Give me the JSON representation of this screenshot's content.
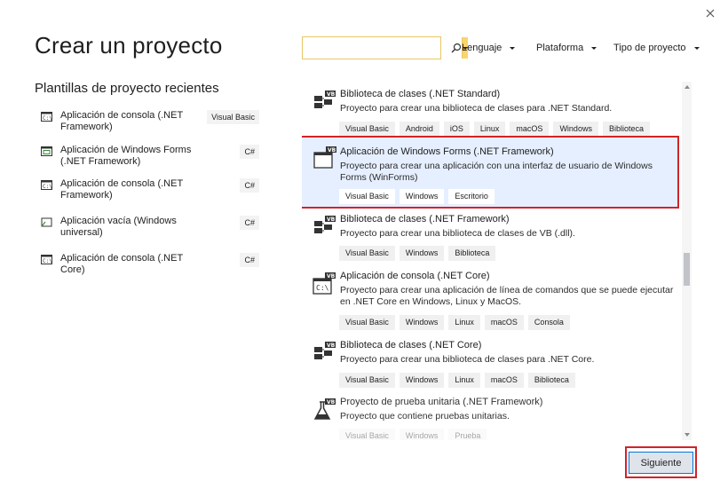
{
  "window": {
    "close_icon": "close-icon"
  },
  "header": {
    "title": "Crear un proyecto",
    "search": {
      "value": "",
      "placeholder": ""
    },
    "filters": {
      "language": "Lenguaje",
      "platform": "Plataforma",
      "project_type": "Tipo de proyecto"
    }
  },
  "recent": {
    "title": "Plantillas de proyecto recientes",
    "items": [
      {
        "label": "Aplicación de consola (.NET Framework)",
        "badge": "Visual Basic",
        "icon": "console-icon"
      },
      {
        "label": "Aplicación de Windows Forms (.NET Framework)",
        "badge": "C#",
        "icon": "windows-forms-icon"
      },
      {
        "label": "Aplicación de consola (.NET Framework)",
        "badge": "C#",
        "icon": "console-icon"
      },
      {
        "label": "Aplicación vacía (Windows universal)",
        "badge": "C#",
        "icon": "uwp-icon"
      },
      {
        "label": "Aplicación de consola (.NET Core)",
        "badge": "C#",
        "icon": "console-icon"
      }
    ]
  },
  "templates": [
    {
      "name": "Biblioteca de clases (.NET Standard)",
      "desc": "Proyecto para crear una biblioteca de clases para .NET Standard.",
      "tags": [
        "Visual Basic",
        "Android",
        "iOS",
        "Linux",
        "macOS",
        "Windows",
        "Biblioteca"
      ],
      "icon": "vb-class-library-icon"
    },
    {
      "name": "Aplicación de Windows Forms (.NET Framework)",
      "desc": "Proyecto para crear una aplicación con una interfaz de usuario de Windows Forms (WinForms)",
      "tags": [
        "Visual Basic",
        "Windows",
        "Escritorio"
      ],
      "icon": "vb-windows-forms-icon"
    },
    {
      "name": "Biblioteca de clases (.NET Framework)",
      "desc": "Proyecto para crear una biblioteca de clases de VB (.dll).",
      "tags": [
        "Visual Basic",
        "Windows",
        "Biblioteca"
      ],
      "icon": "vb-class-library-icon"
    },
    {
      "name": "Aplicación de consola (.NET Core)",
      "desc": "Proyecto para crear una aplicación de línea de comandos que se puede ejecutar en .NET Core en Windows, Linux y MacOS.",
      "tags": [
        "Visual Basic",
        "Windows",
        "Linux",
        "macOS",
        "Consola"
      ],
      "icon": "vb-console-icon"
    },
    {
      "name": "Biblioteca de clases (.NET Core)",
      "desc": "Proyecto para crear una biblioteca de clases para .NET Core.",
      "tags": [
        "Visual Basic",
        "Windows",
        "Linux",
        "macOS",
        "Biblioteca"
      ],
      "icon": "vb-class-library-icon"
    },
    {
      "name": "Proyecto de prueba unitaria (.NET Framework)",
      "desc": "Proyecto que contiene pruebas unitarias.",
      "tags": [
        "Visual Basic",
        "Windows",
        "Prueba"
      ],
      "icon": "vb-unit-test-icon"
    }
  ],
  "footer": {
    "next_label": "Siguiente"
  },
  "colors": {
    "accent": "#0078d7",
    "highlight": "#d2232b",
    "selected_bg": "#e6efff",
    "search_border": "#e8c766"
  }
}
